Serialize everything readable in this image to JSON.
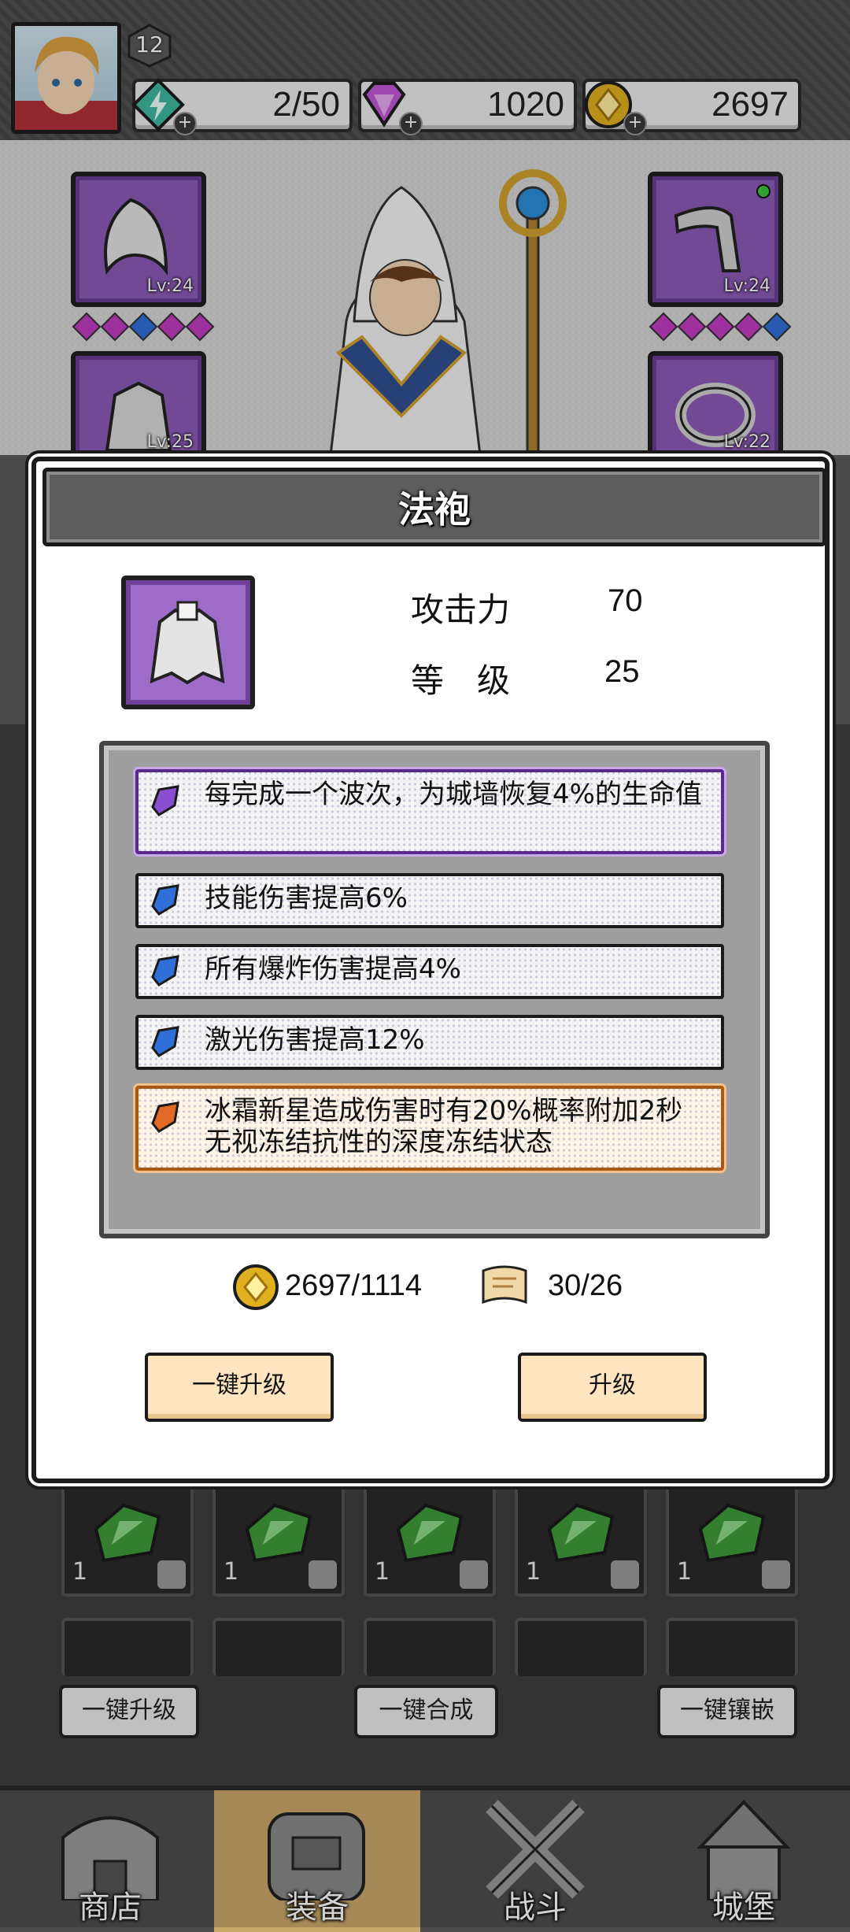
{
  "player": {
    "level": "12"
  },
  "resources": {
    "energy": {
      "value": "2/50",
      "icon": "lightning-gem-icon",
      "color": "#3fb8a0"
    },
    "diamond": {
      "value": "1020",
      "icon": "diamond-icon",
      "color": "#c157d6"
    },
    "gold": {
      "value": "2697",
      "icon": "gold-coin-icon",
      "color": "#e0b020"
    }
  },
  "equipment_slots": [
    {
      "name": "hood",
      "level": "Lv:24"
    },
    {
      "name": "robe",
      "level": "Lv:25"
    },
    {
      "name": "pipe",
      "level": "Lv:24"
    },
    {
      "name": "ring",
      "level": "Lv:22"
    }
  ],
  "modal": {
    "title": "法袍",
    "stats": [
      {
        "label": "攻击力",
        "value": "70"
      },
      {
        "label": "等　级",
        "value": "25"
      }
    ],
    "affixes": [
      {
        "text": "每完成一个波次，为城墙恢复4%的生命值",
        "rarity": "purple"
      },
      {
        "text": "技能伤害提高6%",
        "rarity": "blue"
      },
      {
        "text": "所有爆炸伤害提高4%",
        "rarity": "blue"
      },
      {
        "text": "激光伤害提高12%",
        "rarity": "blue"
      },
      {
        "text": "冰霜新星造成伤害时有20%概率附加2秒无视冻结抗性的深度冻结状态",
        "rarity": "orange"
      }
    ],
    "costs": {
      "gold": "2697/1114",
      "scroll": "30/26"
    },
    "buttons": {
      "auto_upgrade": "一键升级",
      "upgrade": "升级"
    }
  },
  "inventory": {
    "gem_count": "1"
  },
  "bottom_buttons": {
    "auto_upgrade": "一键升级",
    "auto_merge": "一键合成",
    "auto_inlay": "一键镶嵌"
  },
  "nav": [
    {
      "label": "商店",
      "icon": "shop-icon"
    },
    {
      "label": "装备",
      "icon": "backpack-icon",
      "active": true
    },
    {
      "label": "战斗",
      "icon": "crossed-swords-icon"
    },
    {
      "label": "城堡",
      "icon": "castle-icon"
    }
  ],
  "colors": {
    "affix_purple": "#8a4fd0",
    "affix_blue": "#2f6fd8",
    "affix_orange": "#e06a25",
    "button_bg": "#ffe5bf"
  }
}
